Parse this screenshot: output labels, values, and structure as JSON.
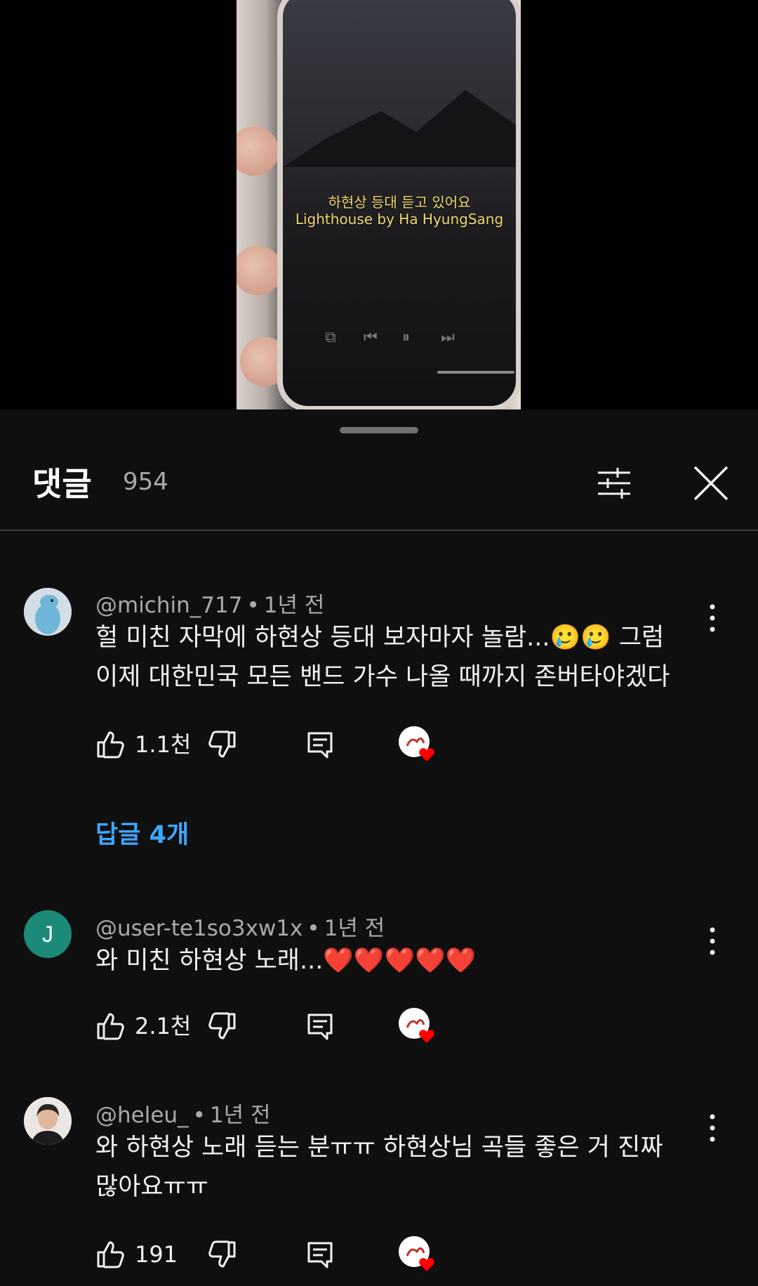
{
  "video": {
    "caption_line1": "하현상 등대 듣고 있어요",
    "caption_line2": "Lighthouse by Ha HyungSang"
  },
  "header": {
    "title": "댓글",
    "count": "954"
  },
  "comments": [
    {
      "author": "@michin_717",
      "time": "1년 전",
      "text_line1": "헐 미친 자막에 하현상 등대 보자마자 놀람...🥲🥲 그럼",
      "text_line2": "이제 대한민국 모든 밴드 가수 나올 때까지 존버타야겠다",
      "likes": "1.1천",
      "replies_label": "답글 4개"
    },
    {
      "author": "@user-te1so3xw1x",
      "avatar_letter": "J",
      "time": "1년 전",
      "text_line1": "와 미친 하현상 노래...❤️❤️❤️❤️❤️",
      "likes": "2.1천"
    },
    {
      "author": "@heleu_",
      "time": "1년 전",
      "text_line1": "와 하현상 노래 듣는 분ㅠㅠ 하현상님 곡들 좋은 거 진짜",
      "text_line2": "많아요ㅠㅠ",
      "likes": "191"
    }
  ],
  "colors": {
    "background": "#0f0f0f",
    "link_blue": "#3ea6ff",
    "secondary_text": "#aaaaaa",
    "heart_red": "#ff0000"
  }
}
